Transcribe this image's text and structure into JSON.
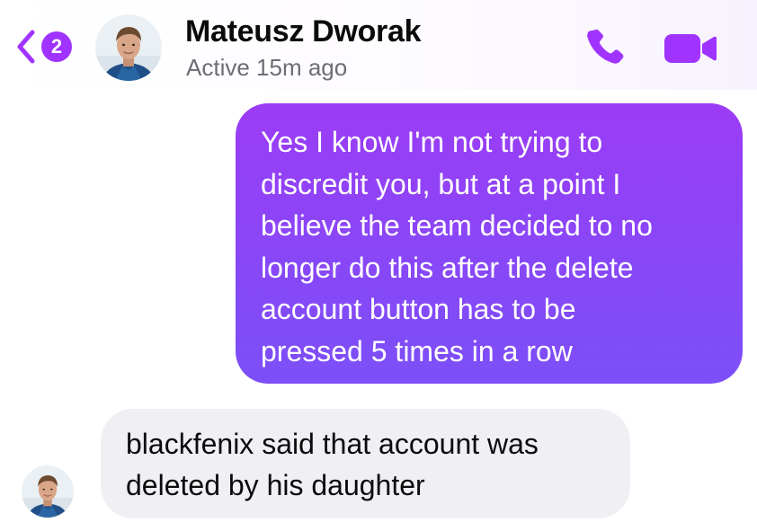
{
  "header": {
    "unread_count": "2",
    "contact_name": "Mateusz Dworak",
    "status": "Active 15m ago",
    "accent_color": "#a033ff"
  },
  "icons": {
    "back": "chevron-left-icon",
    "call": "phone-icon",
    "video": "video-camera-icon"
  },
  "messages": [
    {
      "direction": "outgoing",
      "lines": [
        "Yes I know I'm not trying to",
        "discredit you, but at a point I",
        "believe the team decided to no",
        "longer do this after the delete",
        "account button has to be",
        "pressed 5 times in a row"
      ]
    },
    {
      "direction": "incoming",
      "lines": [
        "blackfenix said that account was",
        "deleted by his daughter"
      ]
    }
  ]
}
